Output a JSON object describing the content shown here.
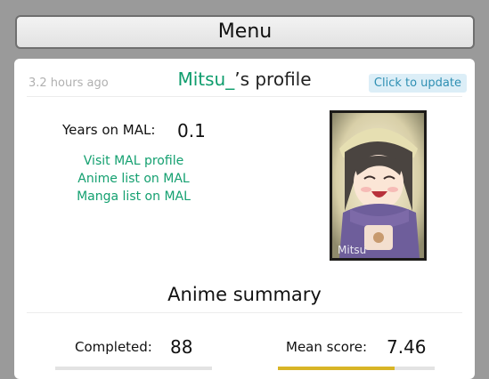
{
  "menu": {
    "label": "Menu"
  },
  "profile": {
    "timestamp": "3.2 hours ago",
    "username": "Mitsu_",
    "title_suffix": "’s profile",
    "update_label": "Click to update",
    "years_label": "Years on MAL:",
    "years_value": "0.1",
    "links": [
      {
        "label": "Visit MAL profile"
      },
      {
        "label": "Anime list on MAL"
      },
      {
        "label": "Manga list on MAL"
      }
    ],
    "avatar_watermark": "Mitsu"
  },
  "anime_summary": {
    "title": "Anime summary",
    "completed_label": "Completed:",
    "completed_value": "88",
    "mean_score_label": "Mean score:",
    "mean_score_value": "7.46",
    "mean_score_fill_fraction": 0.746
  },
  "colors": {
    "username": "#0f9d6d",
    "link": "#14a070",
    "update_bg": "#dceef7",
    "update_text": "#2e8fb3",
    "bar_fill": "#d8b526"
  }
}
